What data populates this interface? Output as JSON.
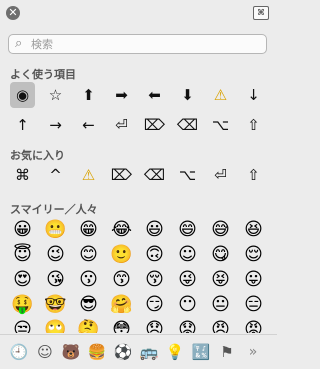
{
  "toolbar": {
    "close_icon": "close-icon",
    "grid_icon": "keyboard-grid-icon",
    "close_glyph": "✕",
    "grid_glyph": "⌘"
  },
  "search": {
    "placeholder": "検索",
    "value": "",
    "icon": "search-icon",
    "icon_glyph": "⌕"
  },
  "sections": {
    "frequent": {
      "title": "よく使う項目"
    },
    "favorites": {
      "title": "お気に入り"
    },
    "smileys": {
      "title": "スマイリー／人々"
    }
  },
  "frequent_symbols": [
    "◉",
    "☆",
    "⬆",
    "➡",
    "⬅",
    "⬇",
    "⚠",
    "↓",
    "↑",
    "→",
    "←",
    "⏎",
    "⌦",
    "⌫",
    "⌥",
    "⇧"
  ],
  "favorite_symbols": [
    "⌘",
    "^",
    "⚠",
    "⌦",
    "⌫",
    "⌥",
    "⏎",
    "⇧"
  ],
  "emojis": [
    "😀",
    "😬",
    "😁",
    "😂",
    "😃",
    "😄",
    "😅",
    "😆",
    "😇",
    "😉",
    "😊",
    "🙂",
    "🙃",
    "☺",
    "😋",
    "😌",
    "😍",
    "😘",
    "😗",
    "😙",
    "😚",
    "😜",
    "😝",
    "😛",
    "🤑",
    "🤓",
    "😎",
    "🤗",
    "😏",
    "😶",
    "😐",
    "😑",
    "😒",
    "🙄",
    "🤔",
    "😳",
    "😞",
    "😟",
    "😠",
    "😡"
  ],
  "categories": [
    {
      "name": "recent",
      "glyph": "🕘",
      "active": true
    },
    {
      "name": "smileys-people",
      "glyph": "☺",
      "active": false
    },
    {
      "name": "animals-nature",
      "glyph": "🐻",
      "active": false
    },
    {
      "name": "food-drink",
      "glyph": "🍔",
      "active": false
    },
    {
      "name": "activity",
      "glyph": "⚽",
      "active": false
    },
    {
      "name": "travel-places",
      "glyph": "🚌",
      "active": false
    },
    {
      "name": "objects",
      "glyph": "💡",
      "active": false
    },
    {
      "name": "symbols",
      "glyph": "🔣",
      "active": false
    },
    {
      "name": "flags",
      "glyph": "⚑",
      "active": false
    },
    {
      "name": "more",
      "glyph": "»",
      "active": false
    }
  ],
  "colors": {
    "accent": "#1e7fe0",
    "warning": "#d9a200"
  }
}
